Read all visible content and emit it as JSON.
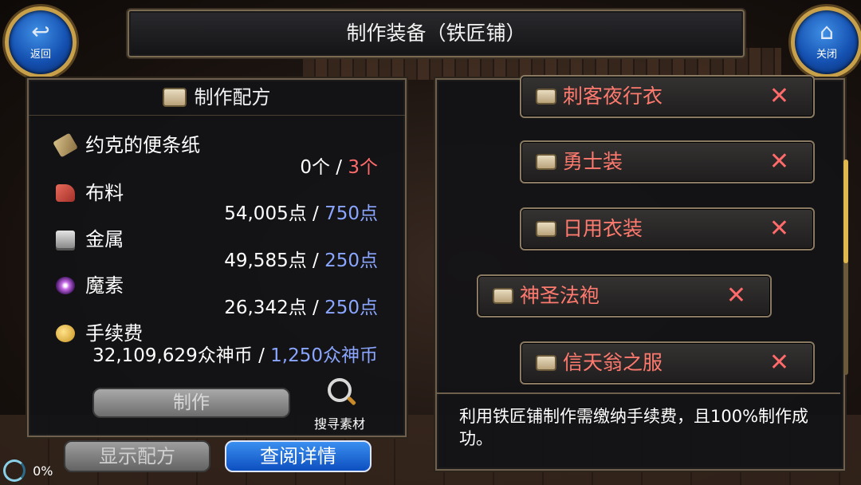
{
  "header": {
    "title": "制作装备（铁匠铺）"
  },
  "nav": {
    "back_label": "返回",
    "close_label": "关闭"
  },
  "recipe_panel": {
    "title": "制作配方",
    "materials": [
      {
        "name": "约克的便条纸",
        "icon": "note-icon",
        "owned": "0个",
        "required": "3个",
        "required_color": "#ff6b6b"
      },
      {
        "name": "布料",
        "icon": "cloth-icon",
        "owned": "54,005点",
        "required": "750点",
        "required_color": "#8aa6ff"
      },
      {
        "name": "金属",
        "icon": "metal-icon",
        "owned": "49,585点",
        "required": "250点",
        "required_color": "#8aa6ff"
      },
      {
        "name": "魔素",
        "icon": "magic-orb-icon",
        "owned": "26,342点",
        "required": "250点",
        "required_color": "#8aa6ff"
      },
      {
        "name": "手续费",
        "icon": "coin-icon",
        "owned": "32,109,629众神币",
        "required": "1,250众神币",
        "required_color": "#8aa6ff"
      }
    ],
    "separator": " / ",
    "make_label": "制作",
    "search_label": "搜寻素材"
  },
  "bottom_buttons": {
    "show_recipe_label": "显示配方",
    "view_detail_label": "查阅详情"
  },
  "equipment_list": {
    "items": [
      {
        "name": "刺客夜行衣",
        "selected": false
      },
      {
        "name": "勇士装",
        "selected": false
      },
      {
        "name": "日用衣装",
        "selected": false
      },
      {
        "name": "神圣法袍",
        "selected": true
      },
      {
        "name": "信天翁之服",
        "selected": false
      }
    ],
    "unavailable_mark": "✕"
  },
  "info": {
    "text": "利用铁匠铺制作需缴纳手续费，且100%制作成功。"
  },
  "status": {
    "loading_percent": "0%"
  },
  "colors": {
    "accent_blue": "#0d4fc0",
    "item_name": "#ff7a6e",
    "frame_gold": "#c9a04a"
  }
}
